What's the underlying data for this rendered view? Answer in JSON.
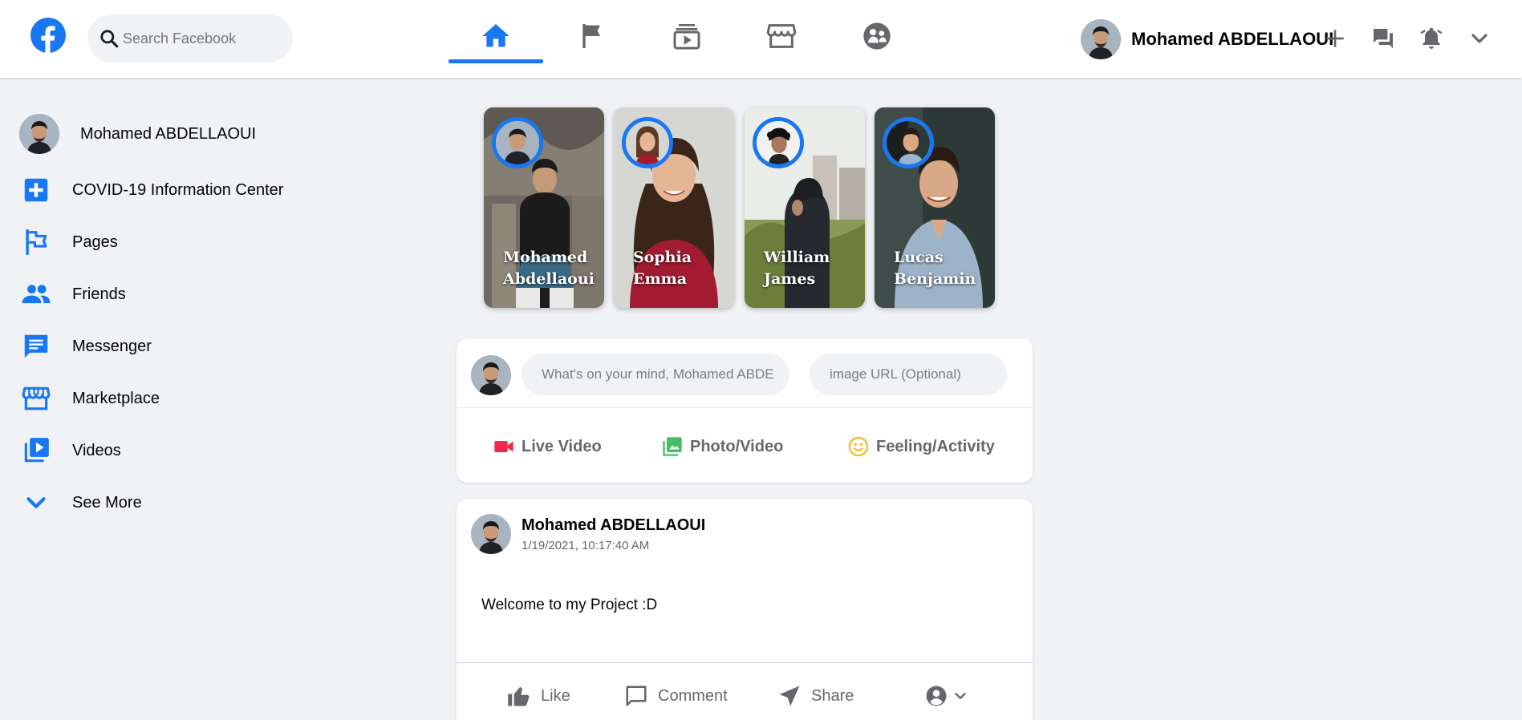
{
  "header": {
    "search_placeholder": "Search Facebook",
    "user_name": "Mohamed ABDELLAOUI",
    "nav_tabs": [
      "home",
      "pages",
      "watch",
      "marketplace",
      "groups"
    ],
    "active_tab": "home"
  },
  "sidebar": {
    "user_name": "Mohamed ABDELLAOUI",
    "items": [
      {
        "label": "COVID-19 Information Center",
        "icon": "plus-square-icon"
      },
      {
        "label": "Pages",
        "icon": "flag-icon"
      },
      {
        "label": "Friends",
        "icon": "people-icon"
      },
      {
        "label": "Messenger",
        "icon": "chat-icon"
      },
      {
        "label": "Marketplace",
        "icon": "store-icon"
      },
      {
        "label": "Videos",
        "icon": "video-library-icon"
      },
      {
        "label": "See More",
        "icon": "chevron-down-icon"
      }
    ]
  },
  "stories": [
    {
      "name_line1": "Mohamed",
      "name_line2": "Abdellaoui"
    },
    {
      "name_line1": "Sophia",
      "name_line2": "Emma"
    },
    {
      "name_line1": "William",
      "name_line2": "James"
    },
    {
      "name_line1": "Lucas",
      "name_line2": "Benjamin"
    }
  ],
  "composer": {
    "message_placeholder": "What's on your mind, Mohamed ABDE",
    "image_placeholder": "image URL (Optional)",
    "actions": [
      {
        "label": "Live Video",
        "icon": "video-camera-icon",
        "color": "#f02849"
      },
      {
        "label": "Photo/Video",
        "icon": "photo-library-icon",
        "color": "#45bd62"
      },
      {
        "label": "Feeling/Activity",
        "icon": "smiley-icon",
        "color": "#f7b928"
      }
    ]
  },
  "post": {
    "author": "Mohamed ABDELLAOUI",
    "timestamp": "1/19/2021, 10:17:40 AM",
    "text": "Welcome to my Project :D",
    "actions": {
      "like": "Like",
      "comment": "Comment",
      "share": "Share"
    }
  },
  "colors": {
    "accent": "#1877f2",
    "background": "#f0f2f5",
    "secondary_text": "#65676b"
  }
}
